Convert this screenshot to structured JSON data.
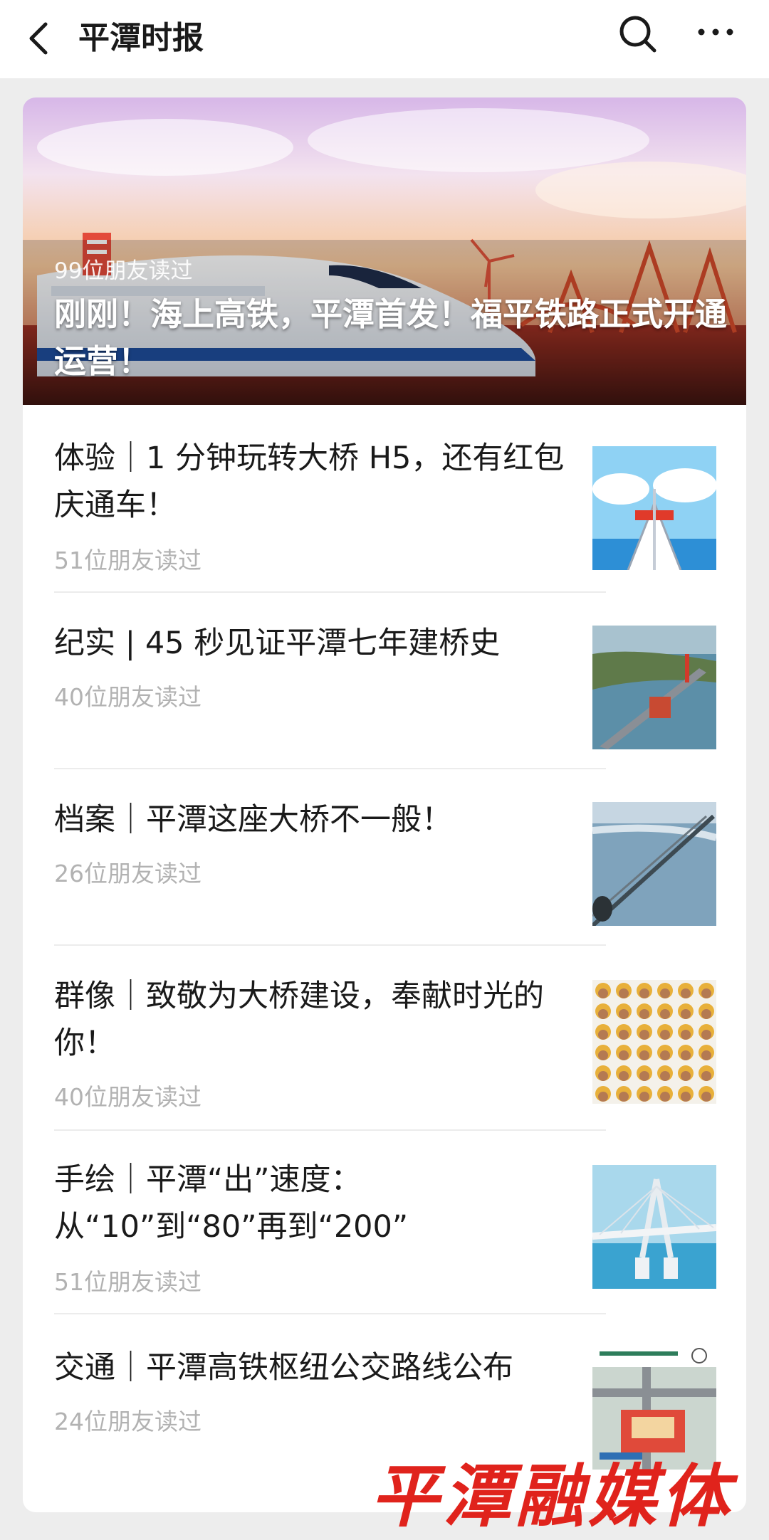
{
  "header": {
    "title": "平潭时报"
  },
  "featured": {
    "reads": "99位朋友读过",
    "title": "刚刚！海上高铁，平潭首发！福平铁路正式开通运营！"
  },
  "articles": [
    {
      "title": "体验｜1 分钟玩转大桥 H5，还有红包庆通车！",
      "reads": "51位朋友读过",
      "thumb_icon": "cartoon-bridge-thumbnail"
    },
    {
      "title": "纪实 | 45 秒见证平潭七年建桥史",
      "reads": "40位朋友读过",
      "thumb_icon": "aerial-bridge-construction-thumbnail"
    },
    {
      "title": "档案｜平潭这座大桥不一般！",
      "reads": "26位朋友读过",
      "thumb_icon": "sea-bridge-aerial-thumbnail"
    },
    {
      "title": "群像｜致敬为大桥建设，奉献时光的你！",
      "reads": "40位朋友读过",
      "thumb_icon": "worker-portraits-grid-thumbnail"
    },
    {
      "title": "手绘｜平潭“出”速度：从“10”到“80”再到“200”",
      "reads": "51位朋友读过",
      "thumb_icon": "hand-drawn-bridge-thumbnail"
    },
    {
      "title": "交通｜平潭高铁枢纽公交路线公布",
      "reads": "24位朋友读过",
      "thumb_icon": "transit-route-map-thumbnail"
    }
  ],
  "watermark": "平潭融媒体",
  "colors": {
    "background": "#ededed",
    "card": "#ffffff",
    "read_count": "#b2b2b2",
    "watermark": "#e0231c"
  }
}
